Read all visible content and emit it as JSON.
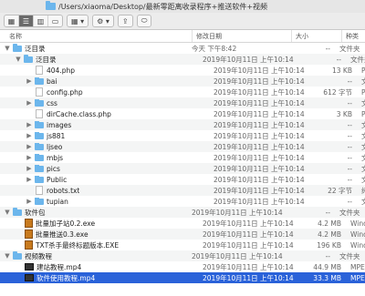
{
  "window": {
    "path": "/Users/xiaoma/Desktop/最新零距离收录程序+推送软件+视频"
  },
  "toolbar": {
    "action_icon": "gear-icon",
    "share_icon": "share-icon",
    "tag_icon": "tag-icon"
  },
  "columns": {
    "name": "名称",
    "date": "修改日期",
    "size": "大小",
    "kind": "种类"
  },
  "rows": [
    {
      "indent": 0,
      "tri": "▼",
      "icon": "folder",
      "name": "泛目录",
      "date": "今天 下午8:42",
      "size": "--",
      "kind": "文件夹"
    },
    {
      "indent": 1,
      "tri": "▼",
      "icon": "folder",
      "name": "泛目录",
      "date": "2019年10月11日 上午10:14",
      "size": "--",
      "kind": "文件夹"
    },
    {
      "indent": 2,
      "tri": "",
      "icon": "file",
      "name": "404.php",
      "date": "2019年10月11日 上午10:14",
      "size": "13 KB",
      "kind": "PHP 脚"
    },
    {
      "indent": 2,
      "tri": "▶",
      "icon": "folder",
      "name": "bai",
      "date": "2019年10月11日 上午10:14",
      "size": "--",
      "kind": "文件夹"
    },
    {
      "indent": 2,
      "tri": "",
      "icon": "file",
      "name": "config.php",
      "date": "2019年10月11日 上午10:14",
      "size": "612 字节",
      "kind": "PHP 脚"
    },
    {
      "indent": 2,
      "tri": "▶",
      "icon": "folder",
      "name": "css",
      "date": "2019年10月11日 上午10:14",
      "size": "--",
      "kind": "文件夹"
    },
    {
      "indent": 2,
      "tri": "",
      "icon": "file",
      "name": "dirCache.class.php",
      "date": "2019年10月11日 上午10:14",
      "size": "3 KB",
      "kind": "PHP 脚"
    },
    {
      "indent": 2,
      "tri": "▶",
      "icon": "folder",
      "name": "images",
      "date": "2019年10月11日 上午10:14",
      "size": "--",
      "kind": "文件夹"
    },
    {
      "indent": 2,
      "tri": "▶",
      "icon": "folder",
      "name": "js881",
      "date": "2019年10月11日 上午10:14",
      "size": "--",
      "kind": "文件夹"
    },
    {
      "indent": 2,
      "tri": "▶",
      "icon": "folder",
      "name": "ljseo",
      "date": "2019年10月11日 上午10:14",
      "size": "--",
      "kind": "文件夹"
    },
    {
      "indent": 2,
      "tri": "▶",
      "icon": "folder",
      "name": "mbjs",
      "date": "2019年10月11日 上午10:14",
      "size": "--",
      "kind": "文件夹"
    },
    {
      "indent": 2,
      "tri": "▶",
      "icon": "folder",
      "name": "pics",
      "date": "2019年10月11日 上午10:14",
      "size": "--",
      "kind": "文件夹"
    },
    {
      "indent": 2,
      "tri": "▶",
      "icon": "folder",
      "name": "Public",
      "date": "2019年10月11日 上午10:14",
      "size": "--",
      "kind": "文件夹"
    },
    {
      "indent": 2,
      "tri": "",
      "icon": "file",
      "name": "robots.txt",
      "date": "2019年10月11日 上午10:14",
      "size": "22 字节",
      "kind": "纯文本"
    },
    {
      "indent": 2,
      "tri": "▶",
      "icon": "folder",
      "name": "tupian",
      "date": "2019年10月11日 上午10:14",
      "size": "--",
      "kind": "文件夹"
    },
    {
      "indent": 0,
      "tri": "▼",
      "icon": "folder",
      "name": "软件包",
      "date": "2019年10月11日 上午10:14",
      "size": "--",
      "kind": "文件夹"
    },
    {
      "indent": 1,
      "tri": "",
      "icon": "exe",
      "name": "批量加子站0.2.exe",
      "date": "2019年10月11日 上午10:14",
      "size": "4.2 MB",
      "kind": "Windo"
    },
    {
      "indent": 1,
      "tri": "",
      "icon": "exe",
      "name": "批量推送0.3.exe",
      "date": "2019年10月11日 上午10:14",
      "size": "4.2 MB",
      "kind": "Windo"
    },
    {
      "indent": 1,
      "tri": "",
      "icon": "exe",
      "name": "TXT杀手最终标题版本.EXE",
      "date": "2019年10月11日 上午10:14",
      "size": "196 KB",
      "kind": "Windo"
    },
    {
      "indent": 0,
      "tri": "▼",
      "icon": "folder",
      "name": "视频教程",
      "date": "2019年10月11日 上午10:14",
      "size": "--",
      "kind": "文件夹"
    },
    {
      "indent": 1,
      "tri": "",
      "icon": "mp4",
      "name": "建站教程.mp4",
      "date": "2019年10月11日 上午10:14",
      "size": "44.9 MB",
      "kind": "MPEG"
    },
    {
      "indent": 1,
      "tri": "",
      "icon": "mp4",
      "name": "软件使用教程.mp4",
      "date": "2019年10月11日 上午10:14",
      "size": "33.3 MB",
      "kind": "MPEG",
      "selected": true
    }
  ]
}
